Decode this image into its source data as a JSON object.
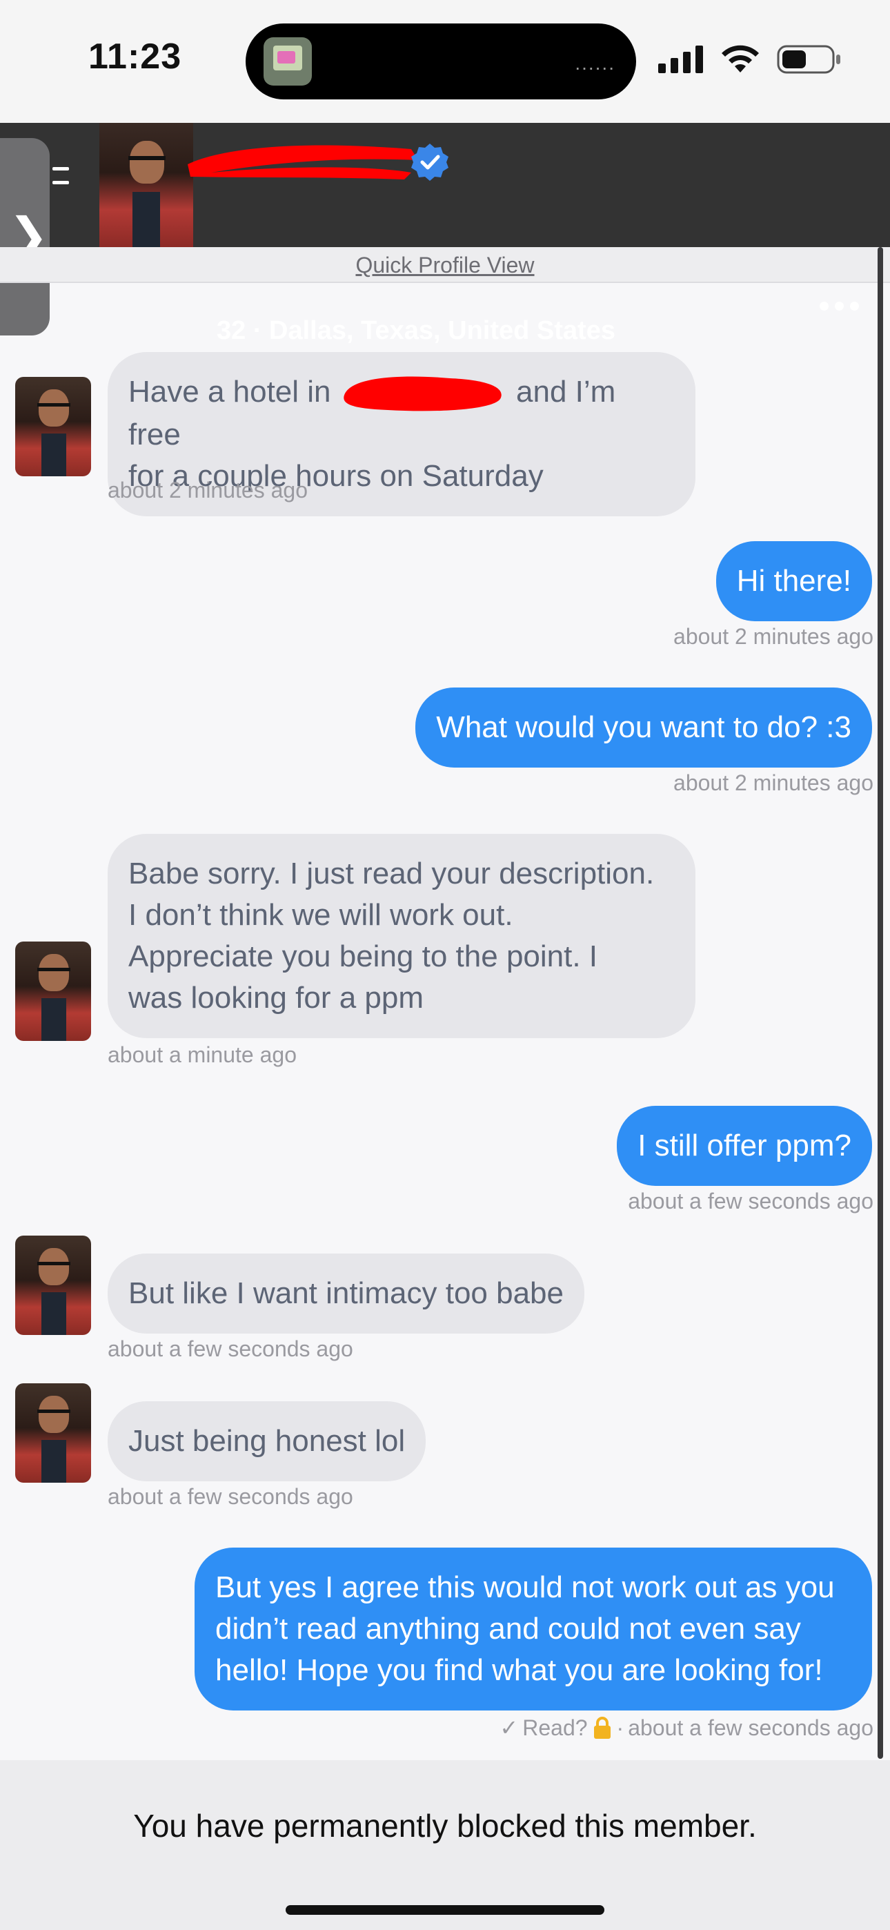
{
  "status_bar": {
    "time": "11:23",
    "island_dots": "......"
  },
  "header": {
    "location": "32 · Dallas, Texas, United States",
    "quick_profile_link": "Quick Profile View",
    "icons": [
      "chevron-right-icon",
      "menu-icon",
      "verified-icon",
      "more-icon"
    ]
  },
  "messages": [
    {
      "direction": "in",
      "text_before_redaction": "Have a hotel in",
      "text_after_redaction": "and I’m free",
      "text_line2": "for a couple hours on Saturday",
      "time": "about 2 minutes ago"
    },
    {
      "direction": "out",
      "text": "Hi there!",
      "time": "about 2 minutes ago"
    },
    {
      "direction": "out",
      "text": "What would you want to do? :3",
      "time": "about 2 minutes ago"
    },
    {
      "direction": "in",
      "lines": [
        "Babe sorry. I just read your description.",
        "I don’t think we will work out.",
        "Appreciate you being to the point. I",
        "was looking for a ppm"
      ],
      "time": "about a minute ago"
    },
    {
      "direction": "out",
      "text": "I still offer ppm?",
      "time": "about a few seconds ago"
    },
    {
      "direction": "in",
      "text": "But like I want intimacy too babe",
      "time": "about a few seconds ago"
    },
    {
      "direction": "in",
      "text": "Just being honest lol",
      "time": "about a few seconds ago"
    },
    {
      "direction": "out",
      "lines": [
        "But yes I agree this would not work out as you",
        "didn’t read anything and could not even say",
        "hello! Hope you find what you are looking for!"
      ],
      "time": "about a few seconds ago"
    }
  ],
  "read_receipt": {
    "checkmark": "✓",
    "label": "Read?",
    "separator": "·",
    "time": "about a few seconds ago"
  },
  "blocked_notice": "You have permanently blocked this member.",
  "colors": {
    "outgoing_bubble": "#2f8ff5",
    "incoming_bubble": "#e6e6ea",
    "header_bg": "#333333",
    "redaction": "#ff0000",
    "verified": "#3a86e8",
    "lock": "#f2b320"
  }
}
